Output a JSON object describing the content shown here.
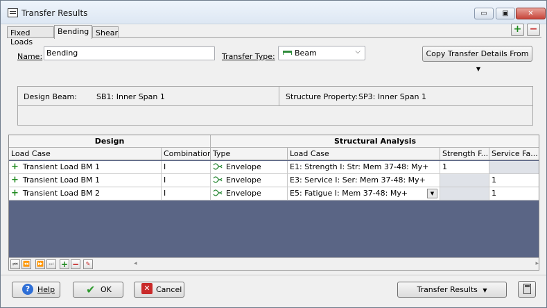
{
  "window": {
    "title": "Transfer Results",
    "minimize": "▭",
    "restore": "▣",
    "close": "✕"
  },
  "tabs": [
    "Fixed Loads",
    "Bending",
    "Shear"
  ],
  "toolbar": {
    "add": "+",
    "remove": "−"
  },
  "form": {
    "name_label": "Name:",
    "name_value": "Bending",
    "transfer_type_label": "Transfer Type:",
    "transfer_type_value": "Beam",
    "copy_button": "Copy Transfer Details From"
  },
  "info": {
    "design_beam_label": "Design Beam:",
    "design_beam_value": "SB1: Inner Span 1",
    "structure_property_label": "Structure Property:",
    "structure_property_value": "SP3: Inner Span 1"
  },
  "grid": {
    "group_design": "Design",
    "group_analysis": "Structural Analysis",
    "columns": [
      "Load Case",
      "Combination",
      "Type",
      "Load Case",
      "Strength F...",
      "Service Fa..."
    ],
    "rows": [
      {
        "load_case": "Transient Load BM 1",
        "combination": "I",
        "type": "Envelope",
        "analysis_case": "E1: Strength I: Str: Mem 37-48: My+",
        "strength": "1",
        "service": ""
      },
      {
        "load_case": "Transient Load BM 1",
        "combination": "I",
        "type": "Envelope",
        "analysis_case": "E3: Service  I: Ser: Mem 37-48: My+",
        "strength": "",
        "service": "1"
      },
      {
        "load_case": "Transient Load BM 2",
        "combination": "I",
        "type": "Envelope",
        "analysis_case": "E5: Fatigue  I: Mem 37-48: My+",
        "strength": "",
        "service": "1"
      }
    ]
  },
  "buttons": {
    "help": "Help",
    "ok": "OK",
    "cancel": "Cancel",
    "transfer_results": "Transfer Results"
  }
}
